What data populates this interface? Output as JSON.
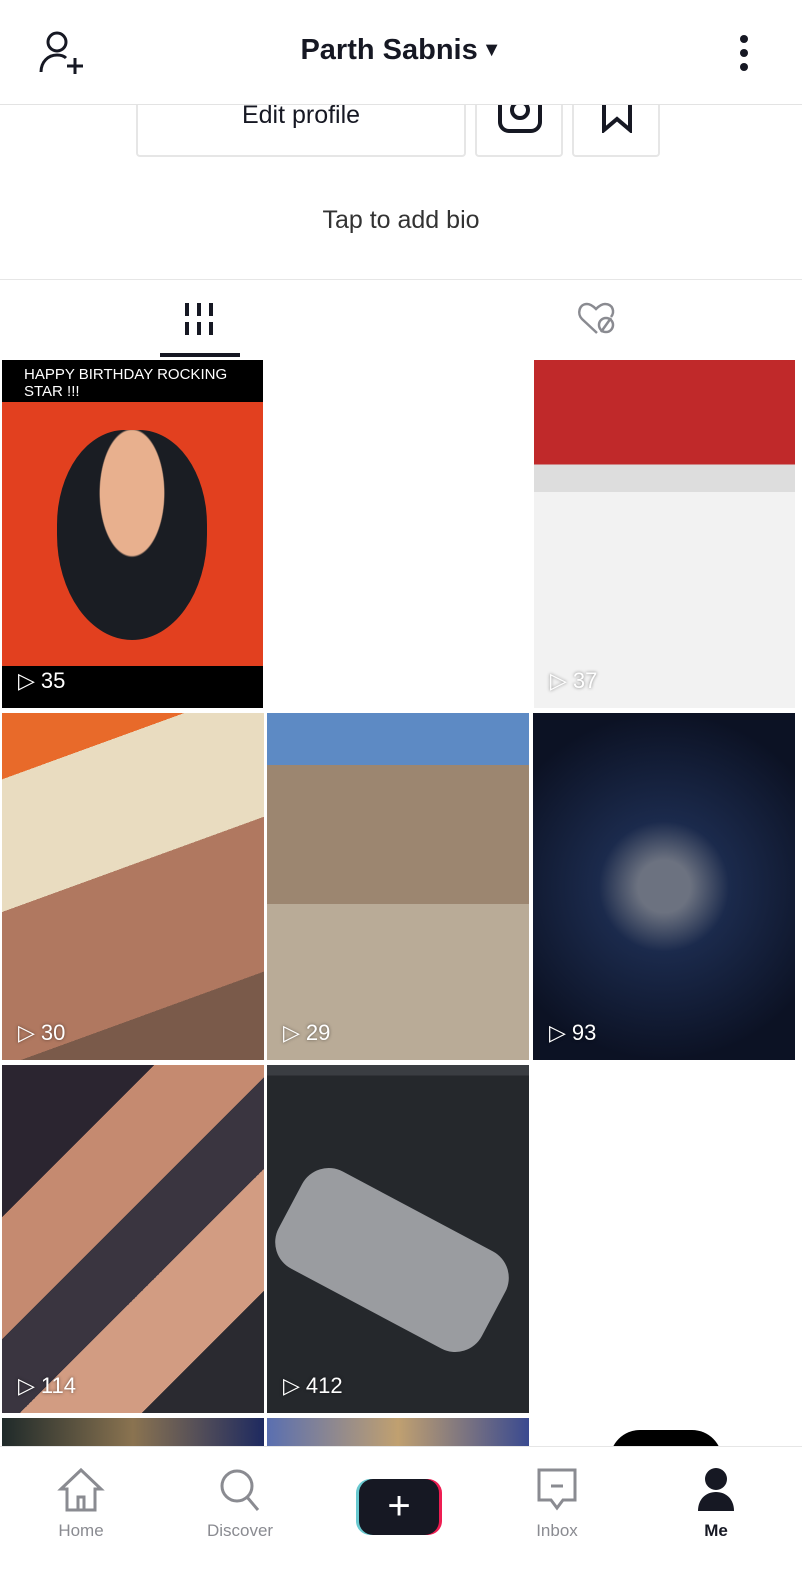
{
  "header": {
    "title": "Parth Sabnis",
    "add_friend_icon": "person-plus-icon",
    "more_icon": "vertical-dots-icon"
  },
  "profile": {
    "edit_profile_label": "Edit profile",
    "instagram_icon": "instagram-icon",
    "bookmark_icon": "bookmark-icon",
    "bio_placeholder": "Tap to add bio"
  },
  "tabs": [
    {
      "icon": "grid-icon",
      "active": true
    },
    {
      "icon": "hidden-heart-icon",
      "active": false
    }
  ],
  "videos": [
    {
      "views": "35",
      "caption": "HAPPY BIRTHDAY ROCKING STAR !!!"
    },
    {
      "views": "37"
    },
    {
      "views": "30"
    },
    {
      "views": "29"
    },
    {
      "views": "93"
    },
    {
      "views": "114"
    },
    {
      "views": "412"
    }
  ],
  "nav": {
    "home": "Home",
    "discover": "Discover",
    "inbox": "Inbox",
    "me": "Me",
    "active": "Me"
  },
  "colors": {
    "accent_cyan": "#69c9d0",
    "accent_red": "#ee1d52",
    "dark": "#161823"
  }
}
